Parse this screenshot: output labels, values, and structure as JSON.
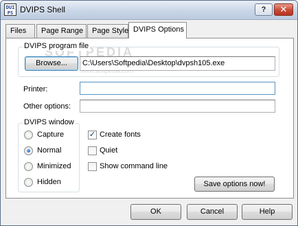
{
  "window": {
    "title": "DVIPS Shell",
    "icon_text": "DUI PS",
    "help_glyph": "?",
    "close_glyph": "✕"
  },
  "tabs": [
    {
      "label": "Files"
    },
    {
      "label": "Page Range"
    },
    {
      "label": "Page Style"
    },
    {
      "label": "DVIPS Options"
    }
  ],
  "program_file": {
    "group_label": "DVIPS program file",
    "browse_label": "Browse...",
    "path_value": "C:\\Users\\Softpedia\\Desktop\\dvpsh105.exe"
  },
  "printer": {
    "label": "Printer:",
    "value": ""
  },
  "other_options": {
    "label": "Other options:",
    "value": ""
  },
  "dvips_window": {
    "group_label": "DVIPS window",
    "options": [
      "Capture",
      "Normal",
      "Minimized",
      "Hidden"
    ],
    "selected": "Normal"
  },
  "checkboxes": [
    {
      "label": "Create fonts",
      "checked": true
    },
    {
      "label": "Quiet",
      "checked": false
    },
    {
      "label": "Show command line",
      "checked": false
    }
  ],
  "save_button_label": "Save options now!",
  "footer": {
    "ok_label": "OK",
    "cancel_label": "Cancel",
    "help_label": "Help"
  },
  "watermark": {
    "big": "SOFTPEDIA",
    "small": "www.softpedia.com"
  }
}
